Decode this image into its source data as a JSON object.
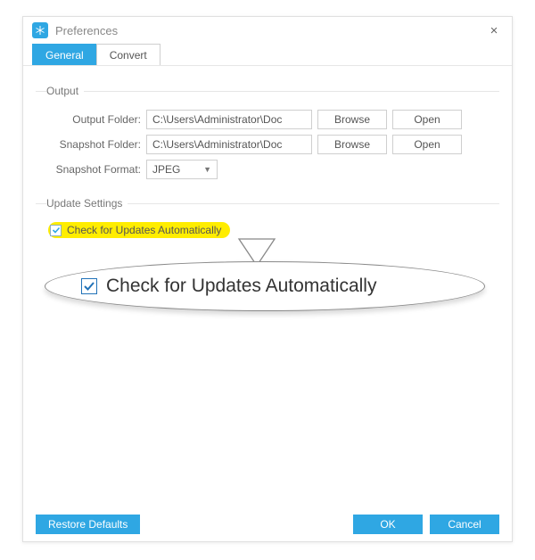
{
  "window": {
    "title": "Preferences",
    "close": "×"
  },
  "tabs": {
    "general": "General",
    "convert": "Convert"
  },
  "output": {
    "legend": "Output",
    "output_folder_label": "Output Folder:",
    "output_folder_value": "C:\\Users\\Administrator\\Doc",
    "snapshot_folder_label": "Snapshot Folder:",
    "snapshot_folder_value": "C:\\Users\\Administrator\\Doc",
    "snapshot_format_label": "Snapshot Format:",
    "snapshot_format_value": "JPEG",
    "browse": "Browse",
    "open": "Open"
  },
  "update": {
    "legend": "Update Settings",
    "check_label": "Check for Updates Automatically"
  },
  "callout": {
    "text": "Check for Updates Automatically"
  },
  "footer": {
    "restore": "Restore Defaults",
    "ok": "OK",
    "cancel": "Cancel"
  }
}
